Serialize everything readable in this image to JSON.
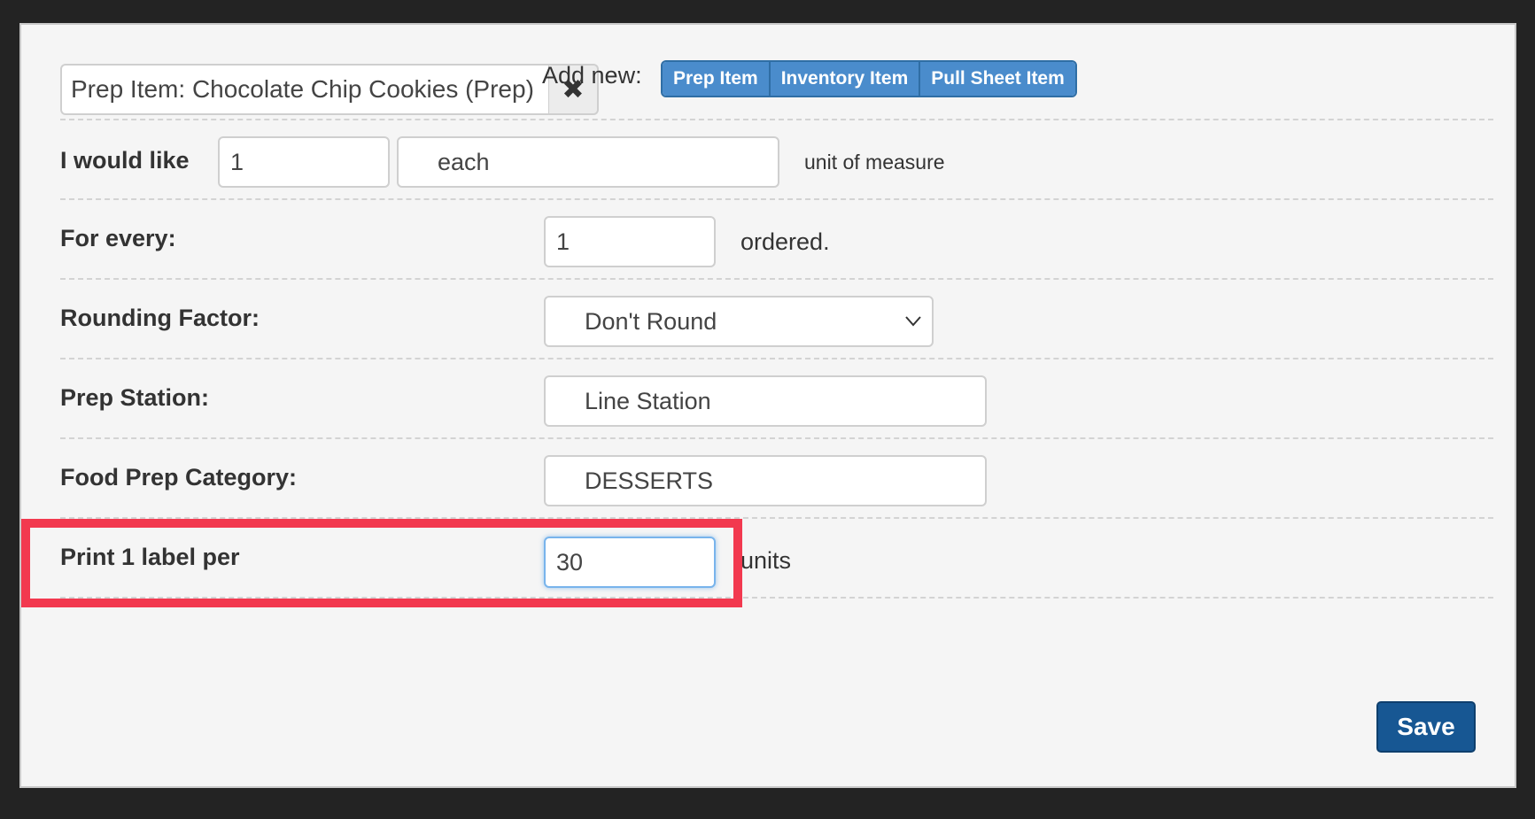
{
  "modal": {
    "item_search": {
      "value": "Prep Item: Chocolate Chip Cookies (Prep)",
      "clear_glyph": "✖"
    },
    "add_new": {
      "label": "Add new:",
      "buttons": [
        "Prep Item",
        "Inventory Item",
        "Pull Sheet Item"
      ]
    },
    "quantity_row": {
      "label": "I would like",
      "quantity": "1",
      "unit": "each",
      "suffix": "unit of measure"
    },
    "for_every_row": {
      "label": "For every:",
      "value": "1",
      "suffix": "ordered."
    },
    "rounding_row": {
      "label": "Rounding Factor:",
      "selected": "Don't Round"
    },
    "prep_station_row": {
      "label": "Prep Station:",
      "value": "Line Station"
    },
    "food_prep_category_row": {
      "label": "Food Prep Category:",
      "value": "DESSERTS"
    },
    "print_label_row": {
      "label": "Print 1 label per",
      "value": "30",
      "suffix": "units"
    },
    "save_label": "Save"
  },
  "colors": {
    "primary_button": "#4a8ccc",
    "save_button": "#175793",
    "highlight": "#f2394f"
  },
  "icons": {
    "clear": "close-icon",
    "dropdown": "chevron-down-icon"
  }
}
